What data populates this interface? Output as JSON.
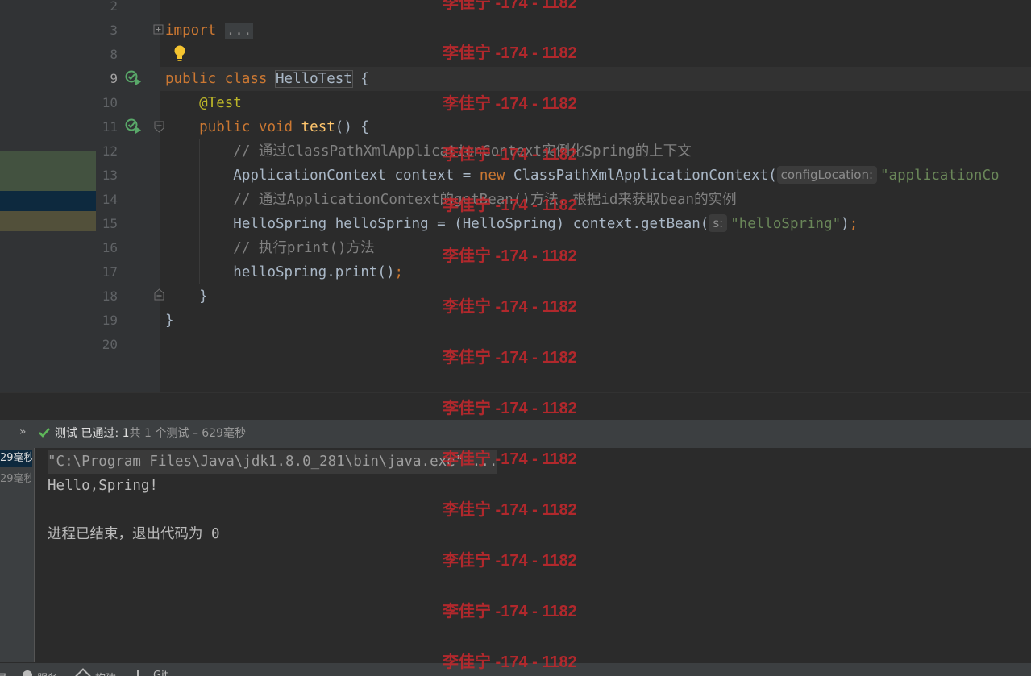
{
  "editor": {
    "line_numbers": [
      "2",
      "3",
      "8",
      "9",
      "10",
      "11",
      "12",
      "13",
      "14",
      "15",
      "16",
      "17",
      "18",
      "19",
      "20"
    ],
    "lines": {
      "l3_kw": "import",
      "l3_fold": "...",
      "l9_kw1": "public",
      "l9_kw2": "class",
      "l9_name": "HelloTest",
      "l9_brace": " {",
      "l10_ann": "@Test",
      "l11_kw1": "public",
      "l11_kw2": "void",
      "l11_fn": "test",
      "l11_rest": "() {",
      "l12_cm": "// 通过ClassPathXmlApplicationContext实例化Spring的上下文",
      "l13_a": "ApplicationContext context = ",
      "l13_new": "new",
      "l13_b": " ClassPathXmlApplicationContext(",
      "l13_hint": "configLocation:",
      "l13_str": "\"applicationCo",
      "l14_cm": "// 通过ApplicationContext的getBean()方法，根据id来获取bean的实例",
      "l15_a": "HelloSpring helloSpring = (HelloSpring) context.getBean(",
      "l15_hint": "s:",
      "l15_str": "\"helloSpring\"",
      "l15_end": ")",
      "l15_semi": ";",
      "l16_cm": "// 执行print()方法",
      "l17_a": "helloSpring.print()",
      "l17_semi": ";",
      "l18": "}",
      "l19": "}"
    }
  },
  "run_panel": {
    "toolbar_chevron": "»",
    "status_label": "测试",
    "passed_label": "已通过:",
    "passed_count": "1",
    "total_text": "共 1 个测试",
    "duration_text": "– 629毫秒",
    "tree_times": [
      "29毫秒",
      "29毫秒"
    ],
    "console_lines": [
      "\"C:\\Program Files\\Java\\jdk1.8.0_281\\bin\\java.exe\" ...",
      "Hello,Spring!",
      "",
      "进程已结束，退出代码为 0"
    ]
  },
  "status_bar": {
    "items": [
      "录",
      "服务",
      "构建",
      "Git"
    ]
  },
  "watermark": {
    "text": "李佳宁 -174 - 1182",
    "color": "#c0282d"
  },
  "colors": {
    "keyword": "#cc7832",
    "string": "#6a8759",
    "comment": "#808080",
    "annotation": "#bbb529",
    "method": "#ffc66d",
    "passed": "#5fb85a"
  }
}
